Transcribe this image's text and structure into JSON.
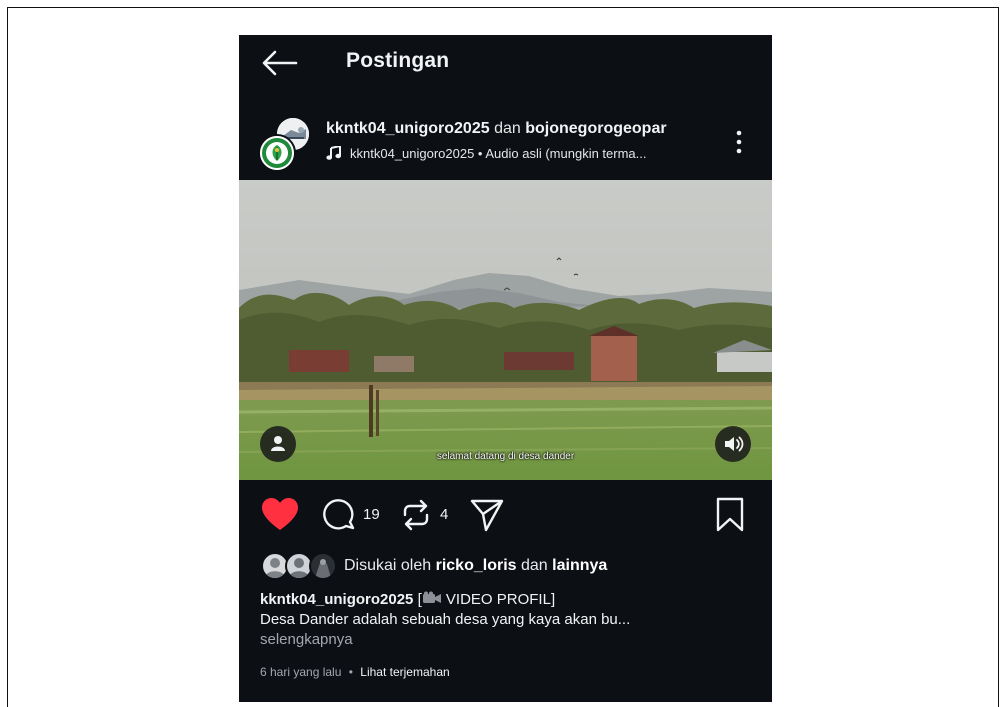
{
  "header": {
    "title": "Postingan",
    "back_icon": "arrow-left-icon"
  },
  "post": {
    "author1": "kkntk04_unigoro2025",
    "joiner": "dan",
    "author2": "bojonegorogeopar",
    "audio_text": "kkntk04_unigoro2025 • Audio asli (mungkin terma...",
    "more_icon": "more-vertical-icon"
  },
  "video": {
    "subtitle": "selamat datang di desa dander",
    "user_tag_icon": "person-icon",
    "sound_icon": "volume-icon"
  },
  "actions": {
    "comment_count": "19",
    "repost_count": "4",
    "like_color": "#ff3040"
  },
  "likes": {
    "prefix": "Disukai oleh",
    "user": "ricko_loris",
    "joiner": "dan",
    "others": "lainnya"
  },
  "caption": {
    "author": "kkntk04_unigoro2025",
    "title_open": "[",
    "title_rest": " VIDEO PROFIL]",
    "body": "Desa Dander adalah sebuah desa yang kaya akan bu...",
    "more": "selengkapnya"
  },
  "meta": {
    "time": "6 hari yang lalu",
    "dot": "•",
    "translate": "Lihat terjemahan"
  }
}
